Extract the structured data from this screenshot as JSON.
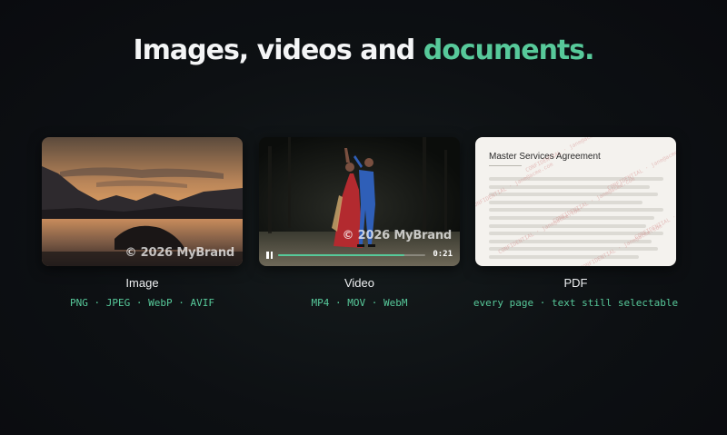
{
  "headline": {
    "prefix": "Images, videos and ",
    "accent": "documents."
  },
  "colors": {
    "accent": "#57c99a",
    "background": "#0c0e12",
    "pdf_watermark": "#cd6e6e"
  },
  "cards": {
    "image": {
      "watermark": "© 2026 MyBrand",
      "caption": "Image",
      "formats": "PNG · JPEG · WebP · AVIF"
    },
    "video": {
      "watermark": "© 2026 MyBrand",
      "time": "0:21",
      "progress": 0.86,
      "caption": "Video",
      "formats": "MP4 · MOV · WebM"
    },
    "pdf": {
      "doc_title": "Master Services Agreement",
      "watermark_text": "CONFIDENTIAL · jane@acme.com",
      "caption": "PDF",
      "formats": "every page · text still selectable"
    }
  }
}
